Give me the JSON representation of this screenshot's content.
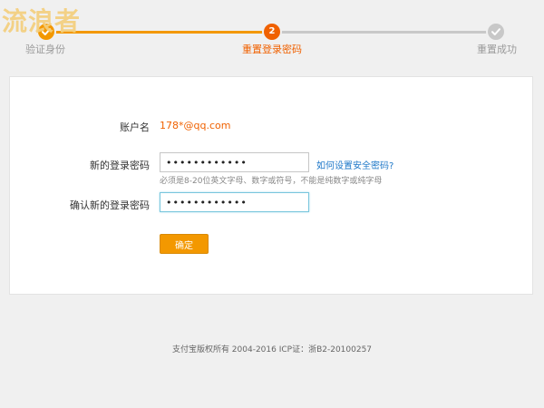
{
  "watermark": "流浪者",
  "stepper": {
    "steps": [
      {
        "label": "验证身份",
        "number": "",
        "state": "done"
      },
      {
        "label": "重置登录密码",
        "number": "2",
        "state": "active"
      },
      {
        "label": "重置成功",
        "number": "",
        "state": "pending"
      }
    ],
    "colors": {
      "done": "#f39800",
      "active": "#f06100",
      "pending": "#c8c8c8"
    }
  },
  "form": {
    "account_label": "账户名",
    "account_value": "178*@qq.com",
    "new_password_label": "新的登录密码",
    "new_password_value": "••••••••••••",
    "help_link": "如何设置安全密码?",
    "hint": "必须是8-20位英文字母、数字或符号，不能是纯数字或纯字母",
    "confirm_password_label": "确认新的登录密码",
    "confirm_password_value": "••••••••••••",
    "submit_label": "确定"
  },
  "footer": {
    "text": "支付宝版权所有 2004-2016 ICP证：浙B2-20100257"
  }
}
